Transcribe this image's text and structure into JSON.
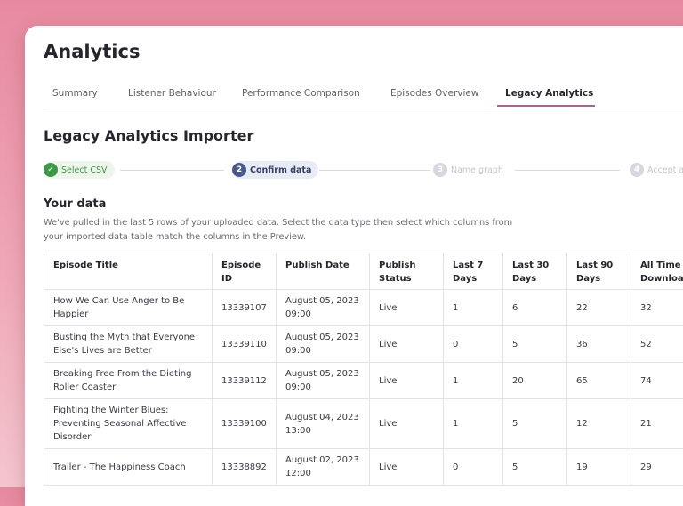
{
  "page": {
    "title": "Analytics"
  },
  "tabs": [
    {
      "label": "Summary",
      "active": false
    },
    {
      "label": "Listener Behaviour",
      "active": false
    },
    {
      "label": "Performance Comparison",
      "active": false
    },
    {
      "label": "Episodes Overview",
      "active": false
    },
    {
      "label": "Legacy Analytics",
      "active": true
    }
  ],
  "importer": {
    "title": "Legacy Analytics Importer",
    "steps": [
      {
        "marker": "✓",
        "label": "Select CSV",
        "state": "done"
      },
      {
        "marker": "2",
        "label": "Confirm data",
        "state": "current"
      },
      {
        "marker": "3",
        "label": "Name graph",
        "state": "pending"
      },
      {
        "marker": "4",
        "label": "Accept and",
        "state": "pending"
      }
    ]
  },
  "your_data": {
    "title": "Your data",
    "description": "We've pulled in the last 5 rows of your uploaded data. Select the data type then select which columns from your imported data table match the columns in the Preview."
  },
  "table": {
    "headers": [
      "Episode Title",
      "Episode ID",
      "Publish Date",
      "Publish Status",
      "Last 7 Days",
      "Last 30 Days",
      "Last 90 Days",
      "All Time Downloads"
    ],
    "rows": [
      [
        "How We Can Use Anger to Be Happier",
        "13339107",
        "August 05, 2023 09:00",
        "Live",
        "1",
        "6",
        "22",
        "32"
      ],
      [
        "Busting the Myth that Everyone Else's Lives are Better",
        "13339110",
        "August 05, 2023 09:00",
        "Live",
        "0",
        "5",
        "36",
        "52"
      ],
      [
        "Breaking Free From the Dieting Roller Coaster",
        "13339112",
        "August 05, 2023 09:00",
        "Live",
        "1",
        "20",
        "65",
        "74"
      ],
      [
        "Fighting the Winter Blues: Preventing Seasonal Affective Disorder",
        "13339100",
        "August 04, 2023 13:00",
        "Live",
        "1",
        "5",
        "12",
        "21"
      ],
      [
        "Trailer - The Happiness Coach",
        "13338892",
        "August 02, 2023 12:00",
        "Live",
        "0",
        "5",
        "19",
        "29"
      ]
    ]
  },
  "colors": {
    "accent_tab": "#a7668a",
    "step_done": "#3a9a45",
    "step_current": "#4b5a8c",
    "background_pink": "#e78aa0"
  }
}
